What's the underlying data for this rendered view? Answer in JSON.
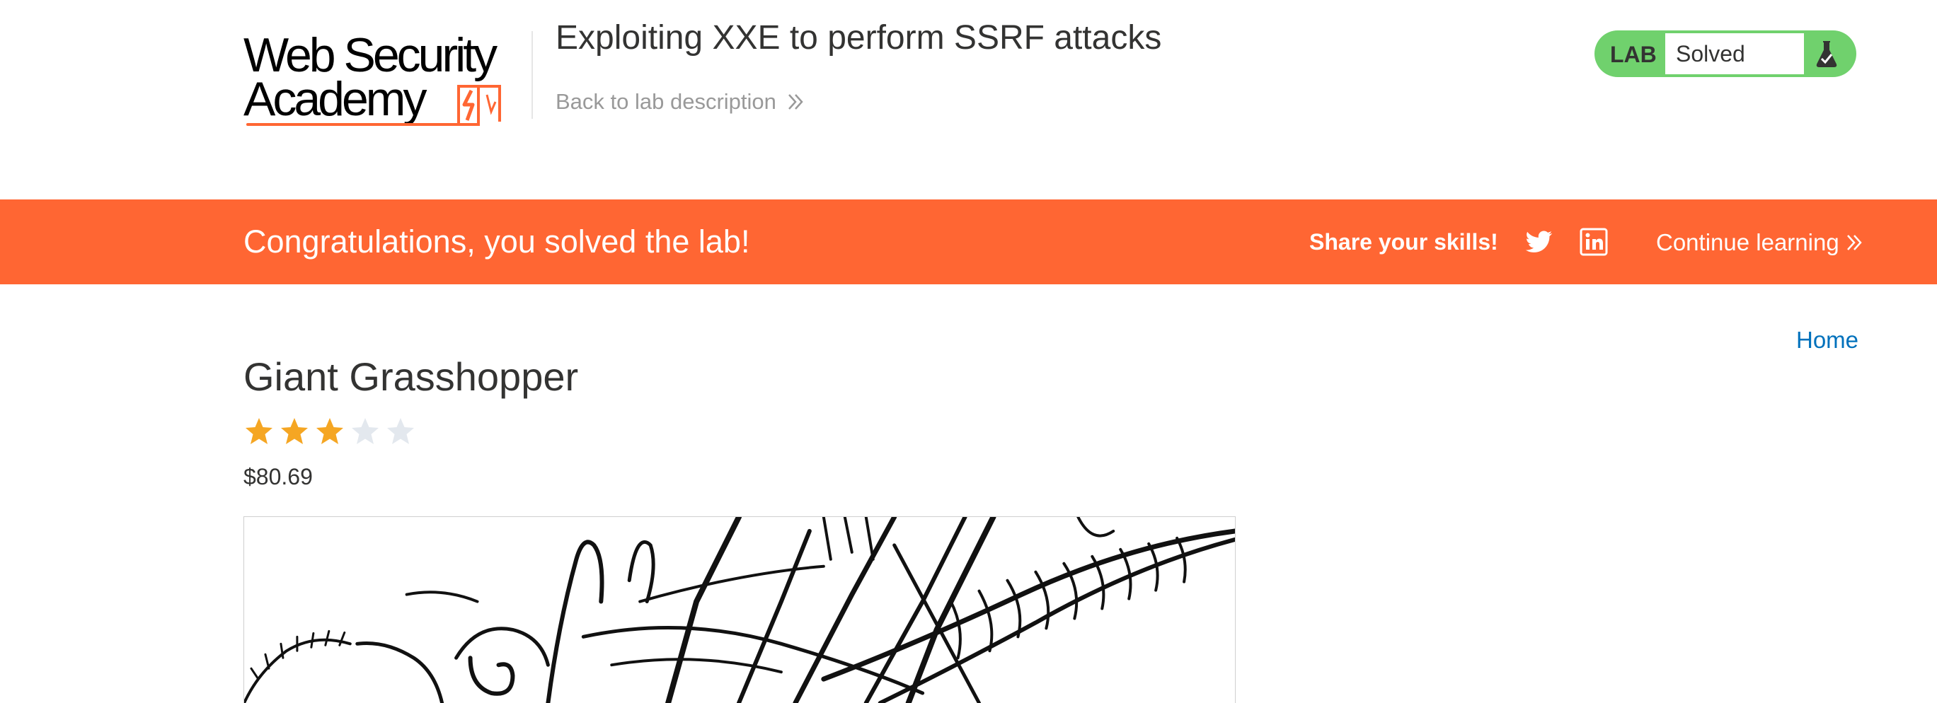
{
  "header": {
    "logo": {
      "line1": "Web Security",
      "line2": "Academy",
      "accent_color": "#ff6633"
    },
    "lab_title": "Exploiting XXE to perform SSRF attacks",
    "back_link": "Back to lab description",
    "lab_status": {
      "label": "LAB",
      "status": "Solved",
      "badge_color": "#70d16d",
      "icon": "flask-icon"
    }
  },
  "banner": {
    "message": "Congratulations, you solved the lab!",
    "share_label": "Share your skills!",
    "social_icons": [
      "twitter-icon",
      "linkedin-icon"
    ],
    "continue_label": "Continue learning",
    "background_color": "#ff6633"
  },
  "nav": {
    "home_label": "Home"
  },
  "product": {
    "name": "Giant Grasshopper",
    "rating": 3,
    "rating_max": 5,
    "price": "$80.69",
    "image_icon": "grasshopper-sketch"
  }
}
